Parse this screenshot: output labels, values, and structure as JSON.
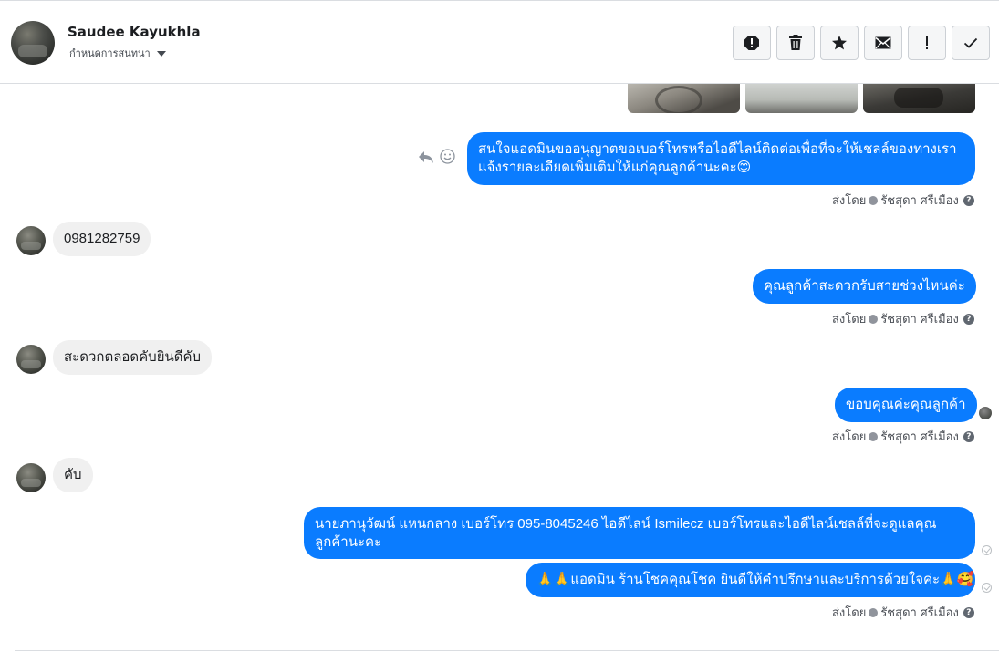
{
  "header": {
    "contact_name": "Saudee Kayukhla",
    "sub_label": "กำหนดการสนทนา",
    "toolbar": [
      {
        "name": "report-icon"
      },
      {
        "name": "trash-icon"
      },
      {
        "name": "star-icon"
      },
      {
        "name": "envelope-icon"
      },
      {
        "name": "exclamation-icon"
      },
      {
        "name": "checkmark-icon"
      }
    ]
  },
  "messages": [
    {
      "side": "out",
      "text": "สนใจแอดมินขออนุญาตขอเบอร์โทรหรือไอดีไลน์ติดต่อเพื่อที่จะให้เชลล์ของทางเรา แจ้งรายละเอียดเพิ่มเติมให้แก่คุณลูกค้านะคะ😊"
    },
    {
      "side": "in",
      "text": "0981282759"
    },
    {
      "side": "out",
      "text": "คุณลูกค้าสะดวกรับสายช่วงไหนค่ะ"
    },
    {
      "side": "in",
      "text": "สะดวกตลอดคับยินดีคับ"
    },
    {
      "side": "out",
      "text": "ขอบคุณค่ะคุณลูกค้า"
    },
    {
      "side": "in",
      "text": "คับ"
    },
    {
      "side": "out",
      "text": "นายภานุวัฒน์ แหนกลาง เบอร์โทร 095-8045246 ไอดีไลน์ Ismilecz  เบอร์โทรและไอดีไลน์เชลล์ที่จะดูแลคุณลูกค้านะคะ"
    },
    {
      "side": "out",
      "text": "🙏🙏แอดมิน ร้านโชคคุณโชค ยินดีให้คำปรึกษาและบริการด้วยใจค่ะ🙏🥰"
    }
  ],
  "sent_by": {
    "prefix": "ส่งโดย",
    "agent": "รัชสุดา ศรีเมือง",
    "help": "?"
  },
  "colors": {
    "outgoing_bubble": "#0a7cff",
    "incoming_bubble": "#f0f0f0"
  }
}
